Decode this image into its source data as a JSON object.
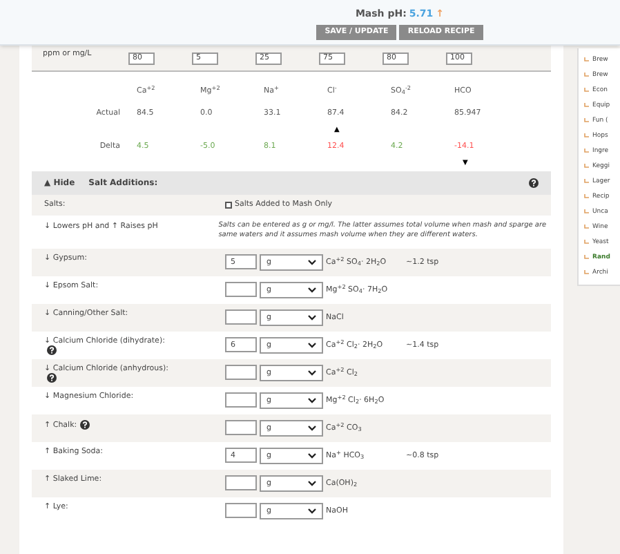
{
  "header": {
    "ph_label": "Mash pH:",
    "ph_value": "5.71",
    "ph_arrow": "↑",
    "buttons": [
      "SAVE / UPDATE",
      "RELOAD RECIPE"
    ]
  },
  "water": {
    "target_label": "ppm or mg/L",
    "actual_label": "Actual",
    "delta_label": "Delta",
    "columns": [
      {
        "header": "Ca$^{+2}$",
        "target": "80",
        "actual": "84.5",
        "delta": "4.5",
        "color": "#6aa84f"
      },
      {
        "header": "Mg$^{+2}$",
        "target": "5",
        "actual": "0.0",
        "delta": "-5.0",
        "color": "#6aa84f"
      },
      {
        "header": "Na$^{+}$",
        "target": "25",
        "actual": "33.1",
        "delta": "8.1",
        "color": "#6aa84f"
      },
      {
        "header": "Cl$^{-}$",
        "target": "75",
        "actual": "87.4",
        "delta": "12.4",
        "color": "#ff4d4d",
        "marker_above": "▲"
      },
      {
        "header": "SO$_{4}$$^{-2}$",
        "target": "80",
        "actual": "84.2",
        "delta": "4.2",
        "color": "#6aa84f"
      },
      {
        "header": "HCO",
        "target": "100",
        "actual": "85.947",
        "delta": "-14.1",
        "color": "#ff4d4d",
        "marker_below": "▼"
      }
    ]
  },
  "salts": {
    "toggle": "▲ Hide",
    "title": "Salt Additions:",
    "salts_label": "Salts:",
    "mash_only": {
      "label": "Salts Added to Mash Only",
      "checked": false
    },
    "legend": "↓ Lowers pH and ↑ Raises pH",
    "note": "Salts can be entered as g or mg/l. The latter assumes total volume when mash and sparge are same waters and it assumes mash volume when they are different waters.",
    "rows": [
      {
        "label": "↓ Gypsum:",
        "help": false,
        "value": "5",
        "unit": "g",
        "formula": "Ca$^{+2}$ SO$_{4}$· 2H$_{2}$O",
        "tsp": "~1.2 tsp"
      },
      {
        "label": "↓ Epsom Salt:",
        "help": false,
        "value": "",
        "unit": "g",
        "formula": "Mg$^{+2}$ SO$_{4}$· 7H$_{2}$O"
      },
      {
        "label": "↓ Canning/Other Salt:",
        "help": false,
        "value": "",
        "unit": "g",
        "formula": "NaCl"
      },
      {
        "label": "↓ Calcium Chloride (dihydrate):",
        "help": true,
        "value": "6",
        "unit": "g",
        "formula": "Ca$^{+2}$ Cl$_{2}$· 2H$_{2}$O",
        "tsp": "~1.4 tsp"
      },
      {
        "label": "↓ Calcium Chloride (anhydrous):",
        "help": true,
        "value": "",
        "unit": "g",
        "formula": "Ca$^{+2}$ Cl$_{2}$"
      },
      {
        "label": "↓ Magnesium Chloride:",
        "help": false,
        "value": "",
        "unit": "g",
        "formula": "Mg$^{+2}$ Cl$_{2}$· 6H$_{2}$O"
      },
      {
        "label": "↑ Chalk:",
        "help": true,
        "value": "",
        "unit": "g",
        "formula": "Ca$^{+2}$ CO$_{3}$"
      },
      {
        "label": "↑ Baking Soda:",
        "help": false,
        "value": "4",
        "unit": "g",
        "formula": "Na$^{+}$ HCO$_{3}$",
        "tsp": "~0.8 tsp"
      },
      {
        "label": "↑ Slaked Lime:",
        "help": false,
        "value": "",
        "unit": "g",
        "formula": "Ca(OH)$_{2}$"
      },
      {
        "label": "↑ Lye:",
        "help": false,
        "value": "",
        "unit": "g",
        "formula": "NaOH"
      }
    ]
  },
  "sidebar": {
    "items": [
      {
        "label": "Brew",
        "selected": false
      },
      {
        "label": "Brew",
        "selected": false
      },
      {
        "label": "Econ",
        "selected": false
      },
      {
        "label": "Equip",
        "selected": false
      },
      {
        "label": "Fun (",
        "selected": false
      },
      {
        "label": "Hops",
        "selected": false
      },
      {
        "label": "Ingre",
        "selected": false
      },
      {
        "label": "Keggi",
        "selected": false
      },
      {
        "label": "Lager",
        "selected": false
      },
      {
        "label": "Recip",
        "selected": false
      },
      {
        "label": "Unca",
        "selected": false
      },
      {
        "label": "Wine",
        "selected": false
      },
      {
        "label": "Yeast",
        "selected": false
      },
      {
        "label": "Rand",
        "selected": true
      },
      {
        "label": "Archi",
        "selected": false
      }
    ]
  }
}
